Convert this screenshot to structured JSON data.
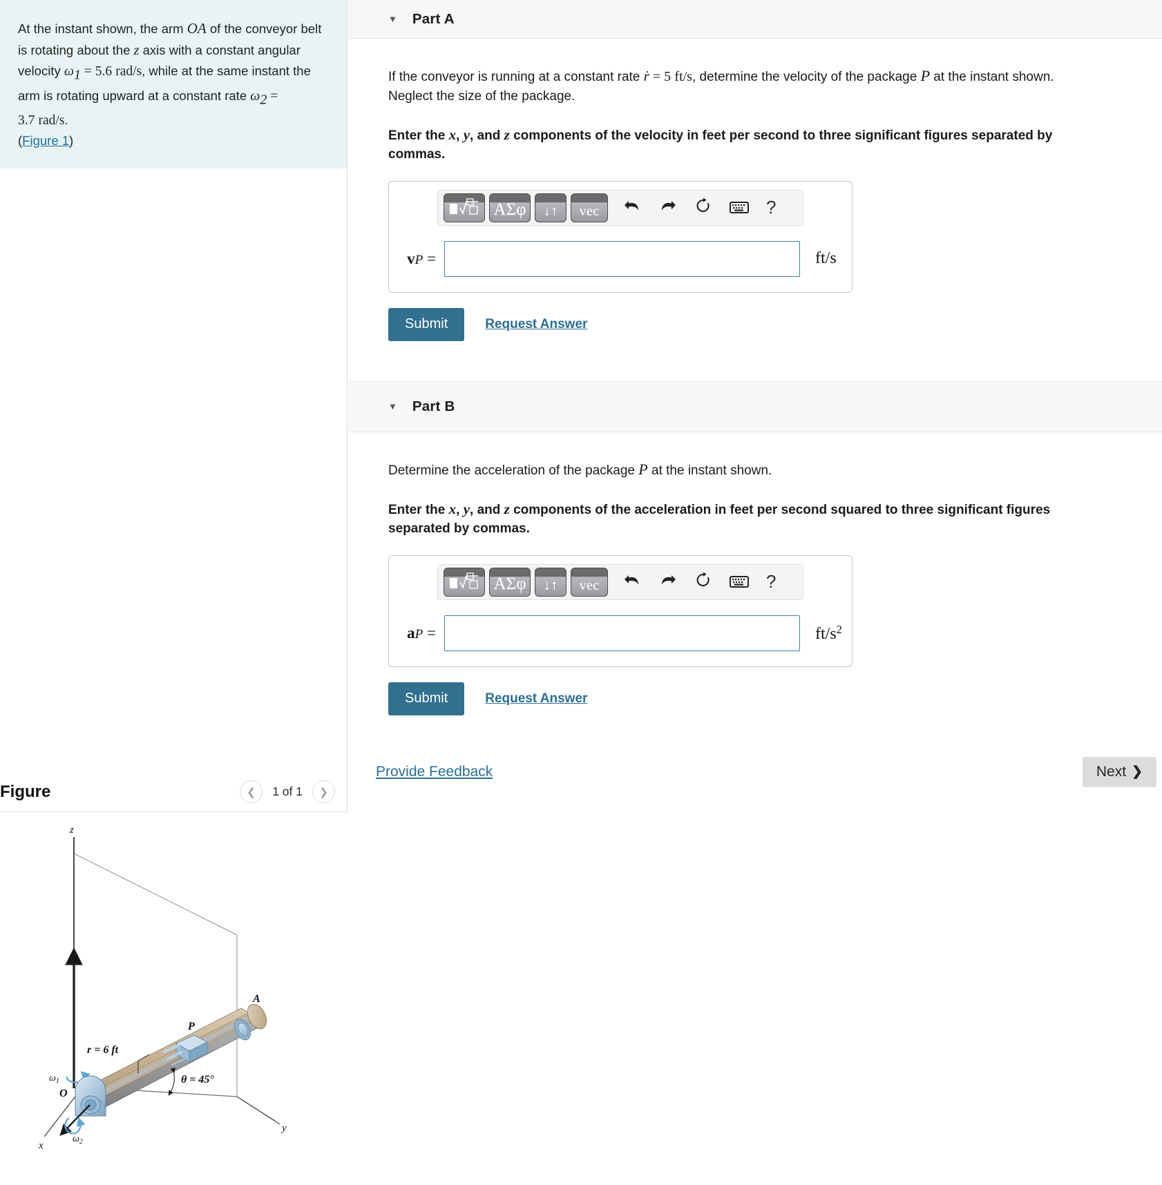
{
  "problem": {
    "text_1": "At the instant shown, the arm ",
    "arm_label": "OA",
    "text_2": " of the conveyor belt is rotating about the ",
    "axis_label": "z",
    "text_3": " axis with a constant angular velocity ",
    "omega1_symbol": "ω",
    "omega1_sub": "1",
    "omega1_eq": " = ",
    "omega1_value": "5.6",
    "omega1_units": "rad/s",
    "text_4": ", while at the same instant the arm is rotating upward at a constant rate ",
    "omega2_symbol": "ω",
    "omega2_sub": "2",
    "omega2_eq": " = ",
    "omega2_value": "3.7",
    "omega2_units": "rad/s",
    "text_5": ".",
    "figure_link": "Figure 1"
  },
  "figure_panel": {
    "title": "Figure",
    "prev_icon": "chevron-left-icon",
    "next_icon": "chevron-right-icon",
    "counter": "1 of 1",
    "labels": {
      "z": "z",
      "x": "x",
      "y": "y",
      "A": "A",
      "P": "P",
      "O": "O",
      "r": "r = 6 ft",
      "theta": "θ = 45°",
      "omega1": "ω",
      "omega1_sub": "1",
      "omega2": "ω",
      "omega2_sub": "2"
    }
  },
  "mathbar": {
    "sqrt_label": "√",
    "greek_label": "ΑΣφ",
    "arrows_label": "↓↑",
    "vec_label": "vec",
    "undo_label": "↰",
    "redo_label": "↱",
    "reset_label": "↻",
    "keyboard_label": "keyboard",
    "help_label": "?"
  },
  "partA": {
    "caret": "▼",
    "label": "Part A",
    "question_pre": "If the conveyor is running at a constant rate ",
    "rate_symbol": "ṙ",
    "rate_eq": " = ",
    "rate_value": "5",
    "rate_units": "ft/s",
    "question_mid": ", determine the velocity of the package ",
    "package_label": "P",
    "question_post": " at the instant shown. Neglect the size of the package.",
    "instruction_pre": "Enter the ",
    "comp_x": "x",
    "comp_y": "y",
    "comp_z": "z",
    "instruction_post": " components of the velocity in feet per second to three significant figures separated by commas.",
    "answer_label_bold": "v",
    "answer_label_sub": "P",
    "answer_label_eq": " =",
    "answer_value": "",
    "unit": "ft/s",
    "submit_label": "Submit",
    "request_answer_label": "Request Answer"
  },
  "partB": {
    "caret": "▼",
    "label": "Part B",
    "question_pre": "Determine the acceleration of the package ",
    "package_label": "P",
    "question_post": " at the instant shown.",
    "instruction_pre": "Enter the ",
    "comp_x": "x",
    "comp_y": "y",
    "comp_z": "z",
    "instruction_post": " components of the acceleration in feet per second squared to three significant figures separated by commas.",
    "answer_label_bold": "a",
    "answer_label_sub": "P",
    "answer_label_eq": " =",
    "answer_value": "",
    "unit_base": "ft/s",
    "unit_exp": "2",
    "submit_label": "Submit",
    "request_answer_label": "Request Answer"
  },
  "footer": {
    "feedback_label": "Provide Feedback",
    "next_label": "Next",
    "next_chevron": "❯"
  },
  "colors": {
    "accent": "#31708f",
    "link": "#2b6e96",
    "problem_bg": "#e8f4f4",
    "part_header_bg": "#f7f7f7",
    "next_btn_bg": "#dcdcdc"
  }
}
